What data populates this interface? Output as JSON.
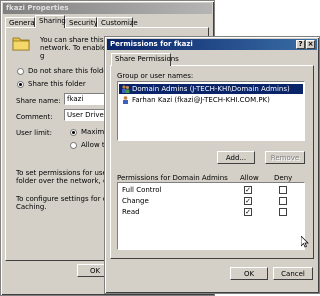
{
  "props_window": {
    "title": "fkazi Properties",
    "tabs": [
      "General",
      "Sharing",
      "Security",
      "Customize"
    ],
    "active_tab": "Sharing",
    "intro": [
      "You can share this folder",
      "network. To enable shari"
    ],
    "intro_suffix": "g",
    "radio_not_share": "Do not share this folder",
    "radio_share": "Share this folder",
    "share_name_label": "Share name:",
    "share_name_value": "fkazi",
    "comment_label": "Comment:",
    "comment_value": "User Drive",
    "user_limit_label": "User limit:",
    "max_allowed": "Maximum a",
    "allow_this": "Allow this n",
    "perm_text": [
      "To set permissions for users wh",
      "folder over the network, click P"
    ],
    "offline_text": [
      "To configure settings for offline",
      "Caching."
    ],
    "ok_label": "OK"
  },
  "perm_window": {
    "title": "Permissions for fkazi",
    "close_glyph": "×",
    "help_glyph": "?",
    "tab": "Share Permissions",
    "group_label": "Group or user names:",
    "users": [
      {
        "name": "Domain Admins (J-TECH-KHI\\Domain Admins)",
        "selected": true
      },
      {
        "name": "Farhan Kazi (fkazi@J-TECH-KHI.COM.PK)",
        "selected": false
      }
    ],
    "add_button": "Add...",
    "remove_button": "Remove",
    "perms_label": "Permissions for Domain Admins",
    "allow_header": "Allow",
    "deny_header": "Deny",
    "permissions": [
      {
        "name": "Full Control",
        "allow": true,
        "deny": false
      },
      {
        "name": "Change",
        "allow": true,
        "deny": false
      },
      {
        "name": "Read",
        "allow": true,
        "deny": false
      }
    ],
    "check_glyph": "✓",
    "ok_button": "OK",
    "cancel_button": "Cancel"
  }
}
